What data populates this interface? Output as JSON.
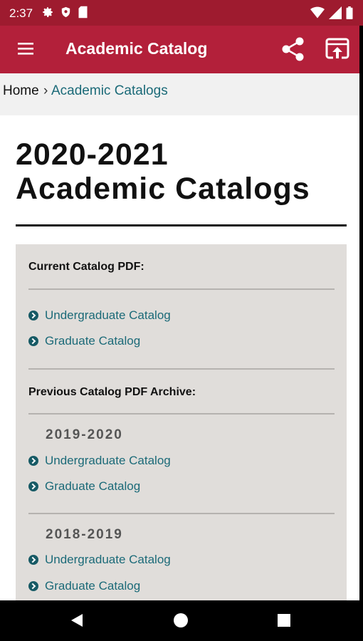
{
  "status_bar": {
    "time": "2:37",
    "icons": [
      "gear-icon",
      "shield-icon",
      "sd-card-icon",
      "wifi-icon",
      "signal-icon",
      "battery-icon"
    ]
  },
  "app_bar": {
    "title": "Academic Catalog",
    "icons": [
      "menu-icon",
      "share-icon",
      "open-in-browser-icon"
    ]
  },
  "breadcrumb": {
    "home": "Home",
    "separator": "›",
    "current": "Academic Catalogs"
  },
  "page": {
    "title_line1": "2020-2021",
    "title_line2": "Academic Catalogs"
  },
  "current": {
    "label": "Current Catalog PDF:",
    "links": [
      "Undergraduate Catalog",
      "Graduate Catalog"
    ]
  },
  "archive": {
    "label": "Previous Catalog PDF Archive:",
    "years": [
      {
        "year": "2019-2020",
        "links": [
          "Undergraduate Catalog",
          "Graduate Catalog"
        ]
      },
      {
        "year": "2018-2019",
        "links": [
          "Undergraduate Catalog",
          "Graduate Catalog"
        ]
      }
    ]
  },
  "colors": {
    "status_bar": "#9e1b2f",
    "app_bar": "#b3203a",
    "link": "#1b6a78",
    "panel": "#e0ddda"
  }
}
